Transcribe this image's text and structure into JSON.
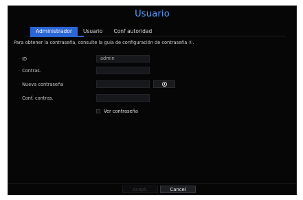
{
  "dialog": {
    "title": "Usuario",
    "tabs": [
      {
        "label": "Administrador",
        "active": true
      },
      {
        "label": "Usuario",
        "active": false
      },
      {
        "label": "Conf autoridad",
        "active": false
      }
    ],
    "info_text": "Para obtener la contraseña, consulte la guía de configuración de contraseña ①.",
    "form": {
      "id": {
        "label": "ID",
        "value": "admin"
      },
      "password": {
        "label": "Contras.",
        "value": ""
      },
      "new_password": {
        "label": "Nueva contraseña",
        "value": ""
      },
      "confirm_password": {
        "label": "Conf. contras.",
        "value": ""
      },
      "show_password": {
        "label": "Ver contraseña",
        "checked": false
      }
    },
    "buttons": {
      "ok_label": "Acept.",
      "cancel_label": "Cancel"
    },
    "icons": {
      "info_button": "info-icon"
    },
    "colors": {
      "accent": "#2a66d6",
      "title": "#5aa0ff",
      "background": "#060607"
    }
  }
}
